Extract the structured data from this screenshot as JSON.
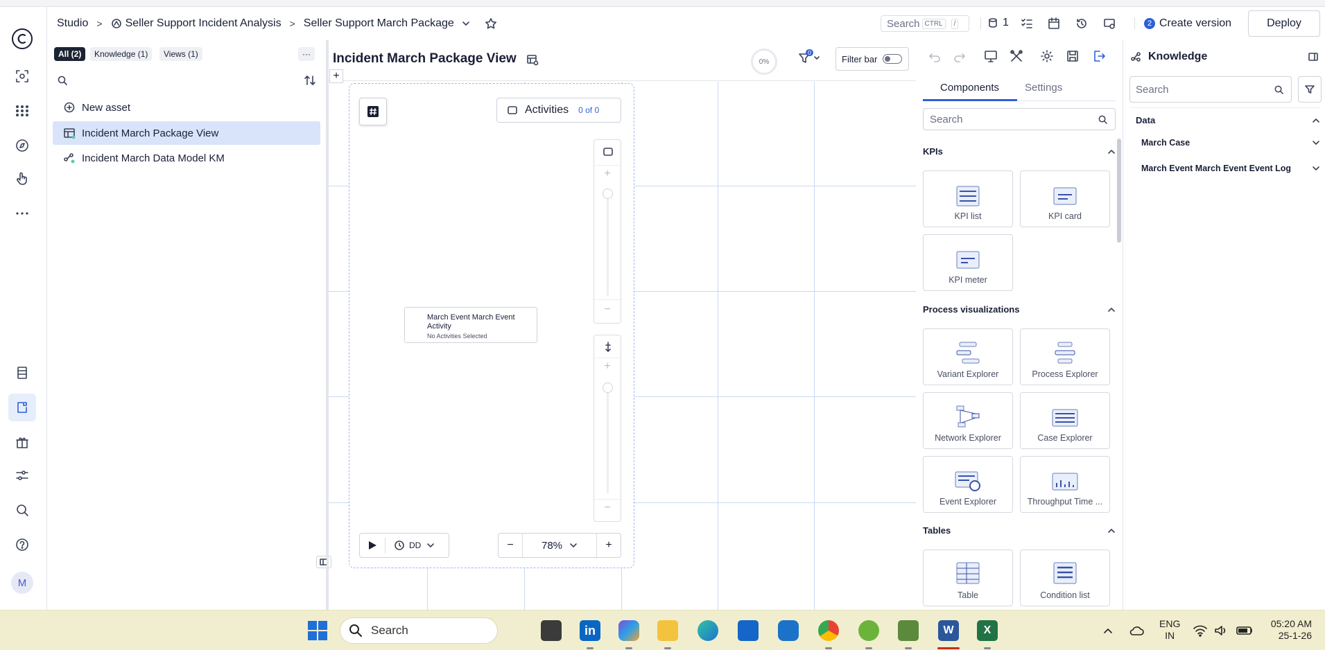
{
  "header": {
    "breadcrumbs": [
      "Studio",
      "Seller Support Incident Analysis",
      "Seller Support March Package"
    ],
    "search_label": "Search",
    "search_kbd": [
      "CTRL",
      "/"
    ],
    "count": "1",
    "create_version_badge": "2",
    "create_version_label": "Create version",
    "deploy_label": "Deploy"
  },
  "assets": {
    "filters": [
      "All (2)",
      "Knowledge (1)",
      "Views (1)"
    ],
    "more": "···",
    "items": [
      {
        "label": "New asset",
        "icon": "plus-circle-icon"
      },
      {
        "label": "Incident March Package View",
        "icon": "view-icon"
      },
      {
        "label": "Incident March Data Model KM",
        "icon": "knowledge-model-icon"
      }
    ]
  },
  "canvas": {
    "title": "Incident March Package View",
    "percent": "0%",
    "filter_count": "0",
    "filter_bar_label": "Filter bar",
    "add_symbol": "+",
    "activities_label": "Activities",
    "activities_count": "0 of 0",
    "node_title": "March Event March Event Activity",
    "node_subtitle": "No Activities Selected",
    "play_dd_label": "DD",
    "zoom_minus": "−",
    "zoom_value": "78%",
    "zoom_plus": "+",
    "slider_plus": "+",
    "slider_minus": "−"
  },
  "components": {
    "tabs": [
      "Components",
      "Settings"
    ],
    "search_placeholder": "Search",
    "sections": [
      {
        "title": "KPIs",
        "tiles": [
          "KPI list",
          "KPI card",
          "KPI meter"
        ]
      },
      {
        "title": "Process visualizations",
        "tiles": [
          "Variant Explorer",
          "Process Explorer",
          "Network Explorer",
          "Case Explorer",
          "Event Explorer",
          "Throughput Time ..."
        ]
      },
      {
        "title": "Tables",
        "tiles": [
          "Table",
          "Condition list"
        ]
      }
    ]
  },
  "knowledge": {
    "title": "Knowledge",
    "search_placeholder": "Search",
    "section": "Data",
    "items": [
      "March Case",
      "March Event March Event Event Log"
    ]
  },
  "taskbar": {
    "search_label": "Search",
    "lang": "ENG",
    "region": "IN",
    "time": "05:20 AM",
    "date": "25-1-26"
  },
  "colors": {
    "accent": "#2f5fd6",
    "selected_row": "#d9e4fb",
    "grid": "#c9d9f2",
    "taskbar": "#f1eecf"
  }
}
